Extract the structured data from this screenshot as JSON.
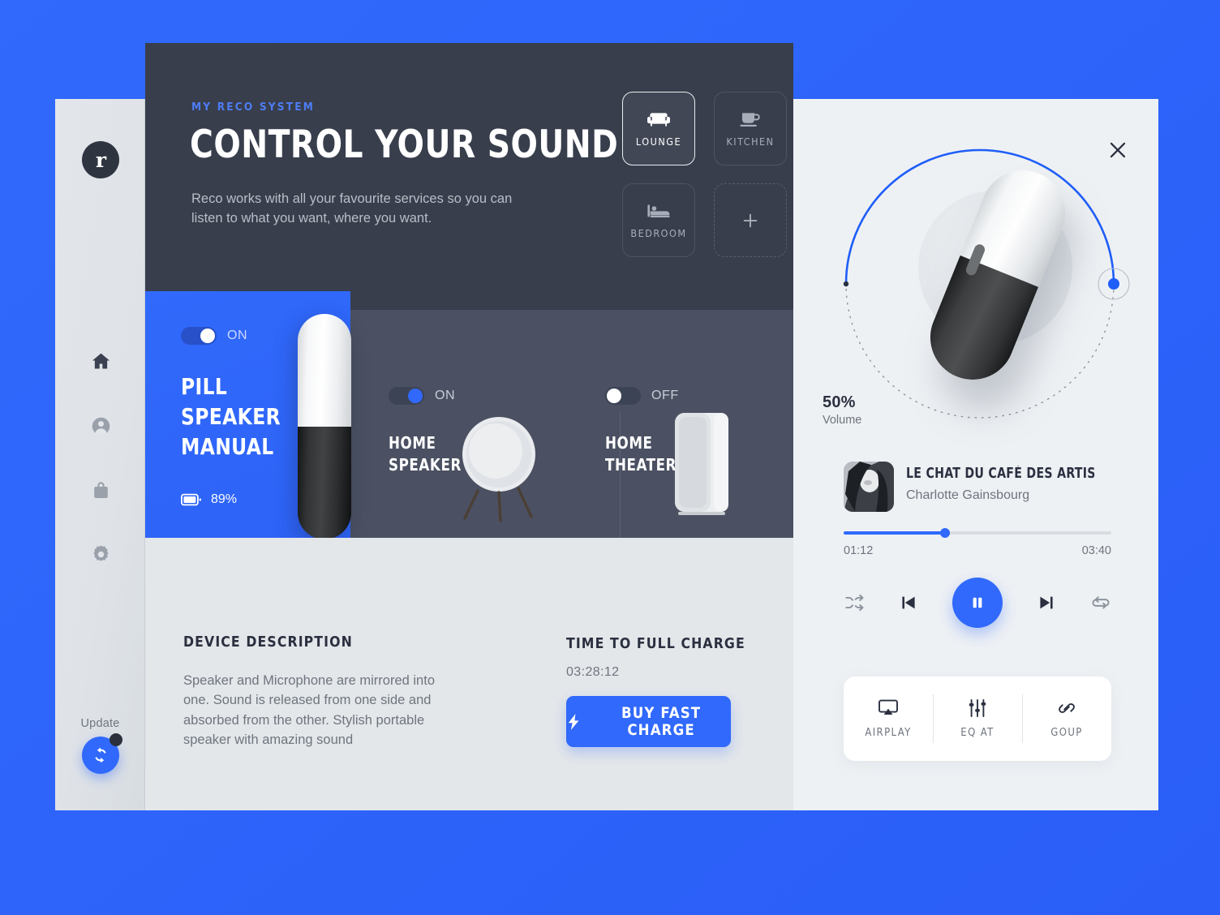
{
  "theme": {
    "background_blue": "#2f66fb",
    "accent_blue": "#3069fb",
    "dark_panel": "#383e4c",
    "mid_panel": "#4b5162",
    "light_panel": "#eef1f4",
    "info_panel": "#e4e7ea",
    "sidebar": "#e2e6ea"
  },
  "sidebar": {
    "logo_letter": "r",
    "items": [
      {
        "label": "home",
        "icon": "home-icon",
        "active": true
      },
      {
        "label": "account",
        "icon": "user-icon",
        "active": false
      },
      {
        "label": "shop",
        "icon": "bag-icon",
        "active": false
      },
      {
        "label": "settings",
        "icon": "gear-icon",
        "active": false
      }
    ],
    "update": {
      "label": "Update",
      "icon": "refresh-icon",
      "has_notification": true
    }
  },
  "hero": {
    "eyebrow": "MY RECO SYSTEM",
    "title": "CONTROL YOUR SOUND",
    "subtitle": "Reco works with all your favourite services so you can listen to what you want, where you want.",
    "rooms": [
      {
        "label": "LOUNGE",
        "icon": "sofa-icon",
        "active": true,
        "add": false
      },
      {
        "label": "KITCHEN",
        "icon": "cup-icon",
        "active": false,
        "add": false
      },
      {
        "label": "BEDROOM",
        "icon": "bed-icon",
        "active": false,
        "add": false
      },
      {
        "label": "",
        "icon": "plus-icon",
        "active": false,
        "add": true
      }
    ]
  },
  "devices": {
    "pill": {
      "toggle_state": "ON",
      "toggle_on": true,
      "name": "PILL SPEAKER MANUAL",
      "battery": "89%",
      "battery_icon": "battery-icon"
    },
    "list": [
      {
        "name": "HOME SPEAKER",
        "toggle_state": "ON",
        "toggle_on": true,
        "image": "round-speaker-image"
      },
      {
        "name": "HOME THEATER",
        "toggle_state": "OFF",
        "toggle_on": false,
        "image": "tower-speaker-image"
      }
    ]
  },
  "info": {
    "description_title": "DEVICE DESCRIPTION",
    "description_body": "Speaker and Microphone are mirrored into one. Sound is released from one side and absorbed from the other. Stylish portable speaker with amazing sound",
    "charge_title": "TIME TO FULL CHARGE",
    "charge_time": "03:28:12",
    "charge_button_label": "BUY FAST CHARGE",
    "charge_button_icon": "bolt-icon"
  },
  "player": {
    "close_icon": "close-icon",
    "volume_value": "50%",
    "volume_label": "Volume",
    "volume_percent": 50,
    "device_image": "pill-speaker-image",
    "track": {
      "title": "LE CHAT DU CAFÉ DES ARTISTES (O...",
      "artist": "Charlotte Gainsbourg",
      "cover": "album-cover-image",
      "elapsed": "01:12",
      "total": "03:40",
      "progress_percent": 38
    },
    "transport": [
      {
        "name": "shuffle",
        "icon": "shuffle-icon"
      },
      {
        "name": "previous",
        "icon": "previous-icon"
      },
      {
        "name": "play-pause",
        "icon": "pause-icon"
      },
      {
        "name": "next",
        "icon": "next-icon"
      },
      {
        "name": "repeat",
        "icon": "repeat-icon"
      }
    ],
    "actions": [
      {
        "label": "AIRPLAY",
        "icon": "airplay-icon"
      },
      {
        "label": "EQ AT",
        "icon": "equalizer-icon"
      },
      {
        "label": "GOUP",
        "icon": "link-icon"
      }
    ]
  }
}
